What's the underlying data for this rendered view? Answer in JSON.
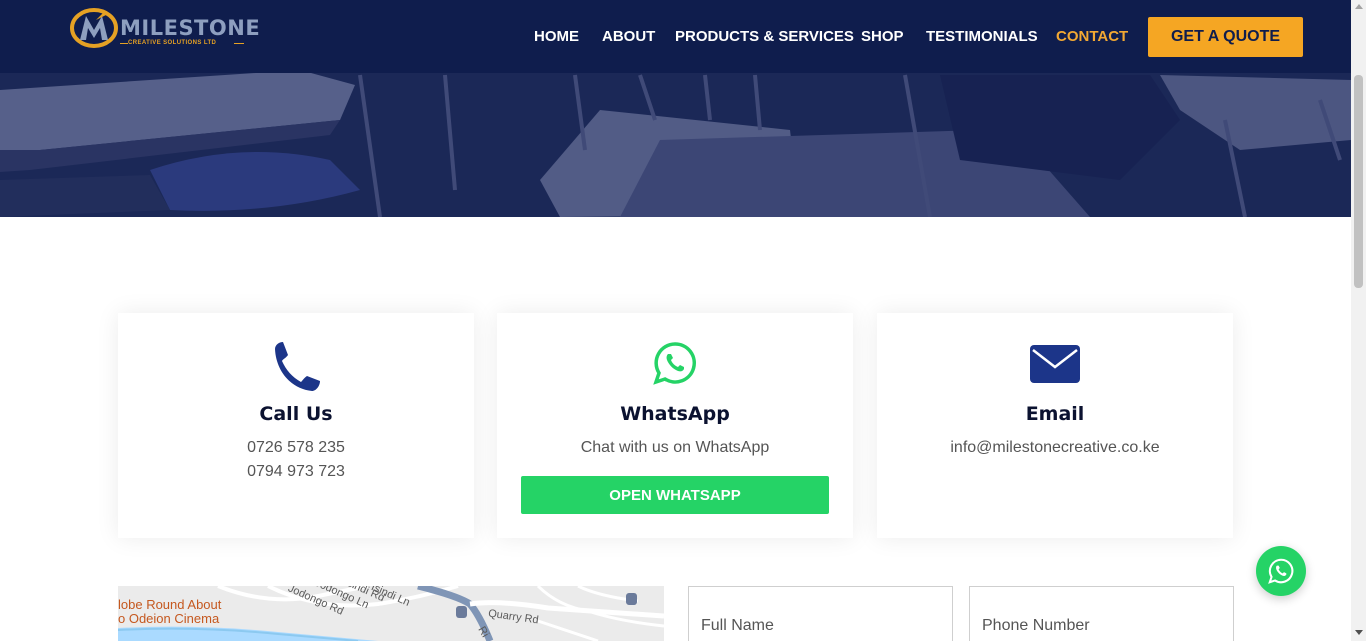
{
  "brand": {
    "name": "MILESTONE",
    "tagline": "CREATIVE SOLUTIONS LTD",
    "colors": {
      "navy": "#0f1d4d",
      "accent": "#f5a623",
      "whatsapp": "#25d366"
    }
  },
  "nav": {
    "items": [
      {
        "label": "HOME"
      },
      {
        "label": "ABOUT"
      },
      {
        "label": "PRODUCTS & SERVICES"
      },
      {
        "label": "SHOP"
      },
      {
        "label": "TESTIMONIALS"
      },
      {
        "label": "CONTACT",
        "active": true
      }
    ],
    "cta": "GET A QUOTE"
  },
  "cards": {
    "call": {
      "icon": "phone-icon",
      "title": "Call Us",
      "lines": [
        "0726 578 235",
        "0794 973 723"
      ]
    },
    "whatsapp": {
      "icon": "whatsapp-icon",
      "title": "WhatsApp",
      "text": "Chat with us on WhatsApp",
      "button": "OPEN WHATSAPP"
    },
    "email": {
      "icon": "envelope-icon",
      "title": "Email",
      "text": "info@milestonecreative.co.ke"
    }
  },
  "map": {
    "labels": [
      "Jodongo Rd",
      "Jodongo Ln",
      "Isindi Ln",
      "Isindi Rd",
      "Quarry Rd",
      "Ri"
    ],
    "pois": [
      "lobe Round About",
      "o Odeion Cinema"
    ]
  },
  "form": {
    "full_name_placeholder": "Full Name",
    "phone_placeholder": "Phone Number"
  },
  "floating": {
    "icon": "whatsapp-icon"
  }
}
